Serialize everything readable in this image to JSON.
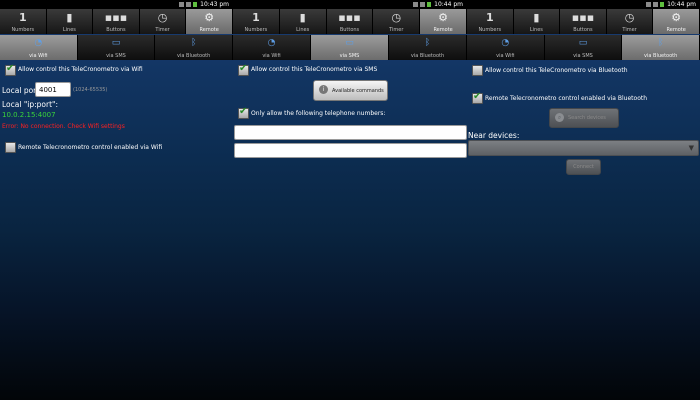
{
  "clock": "10:43 pm",
  "clock2": "10:44 pm",
  "tabs_top": [
    {
      "label": "Numbers",
      "icon": "1"
    },
    {
      "label": "Lines",
      "icon": "▮"
    },
    {
      "label": "Buttons",
      "icon": "▪▪▪"
    },
    {
      "label": "Timer",
      "icon": "◷"
    },
    {
      "label": "Remote",
      "icon": "⚙"
    }
  ],
  "tabs_sub": [
    {
      "label": "via Wifi",
      "icon": "◔"
    },
    {
      "label": "via SMS",
      "icon": "▭"
    },
    {
      "label": "via Bluetooth",
      "icon": "ᛒ"
    }
  ],
  "wifi": {
    "allow_label": "Allow control this TeleCronometro via Wifi",
    "local_port_label": "Local port:",
    "local_port_value": "4001",
    "port_range": "(1024-65535)",
    "ipport_label": "Local \"ip:port\":",
    "ipport_value": "10.0.2.15:4007",
    "error_text": "Error: No connection. Check Wifi settings",
    "remote_label": "Remote Telecronometro control enabled via Wifi"
  },
  "sms": {
    "allow_label": "Allow control this TeleCronometro via SMS",
    "commands_button": "Available commands",
    "only_allow_label": "Only allow the following telephone numbers:",
    "number1": "",
    "number2": ""
  },
  "bt": {
    "allow_label": "Allow control this TeleCronometro via Bluetooth",
    "remote_label": "Remote Telecronometro control enabled via Bluetooth",
    "search_button": "Search devices",
    "near_label": "Near devices:",
    "spinner_value": "",
    "connect_button": "Connect"
  },
  "colors": {
    "accent_green": "#3ad43a",
    "error_red": "#ff2020",
    "tab_icon_blue": "#5e9ee6"
  }
}
